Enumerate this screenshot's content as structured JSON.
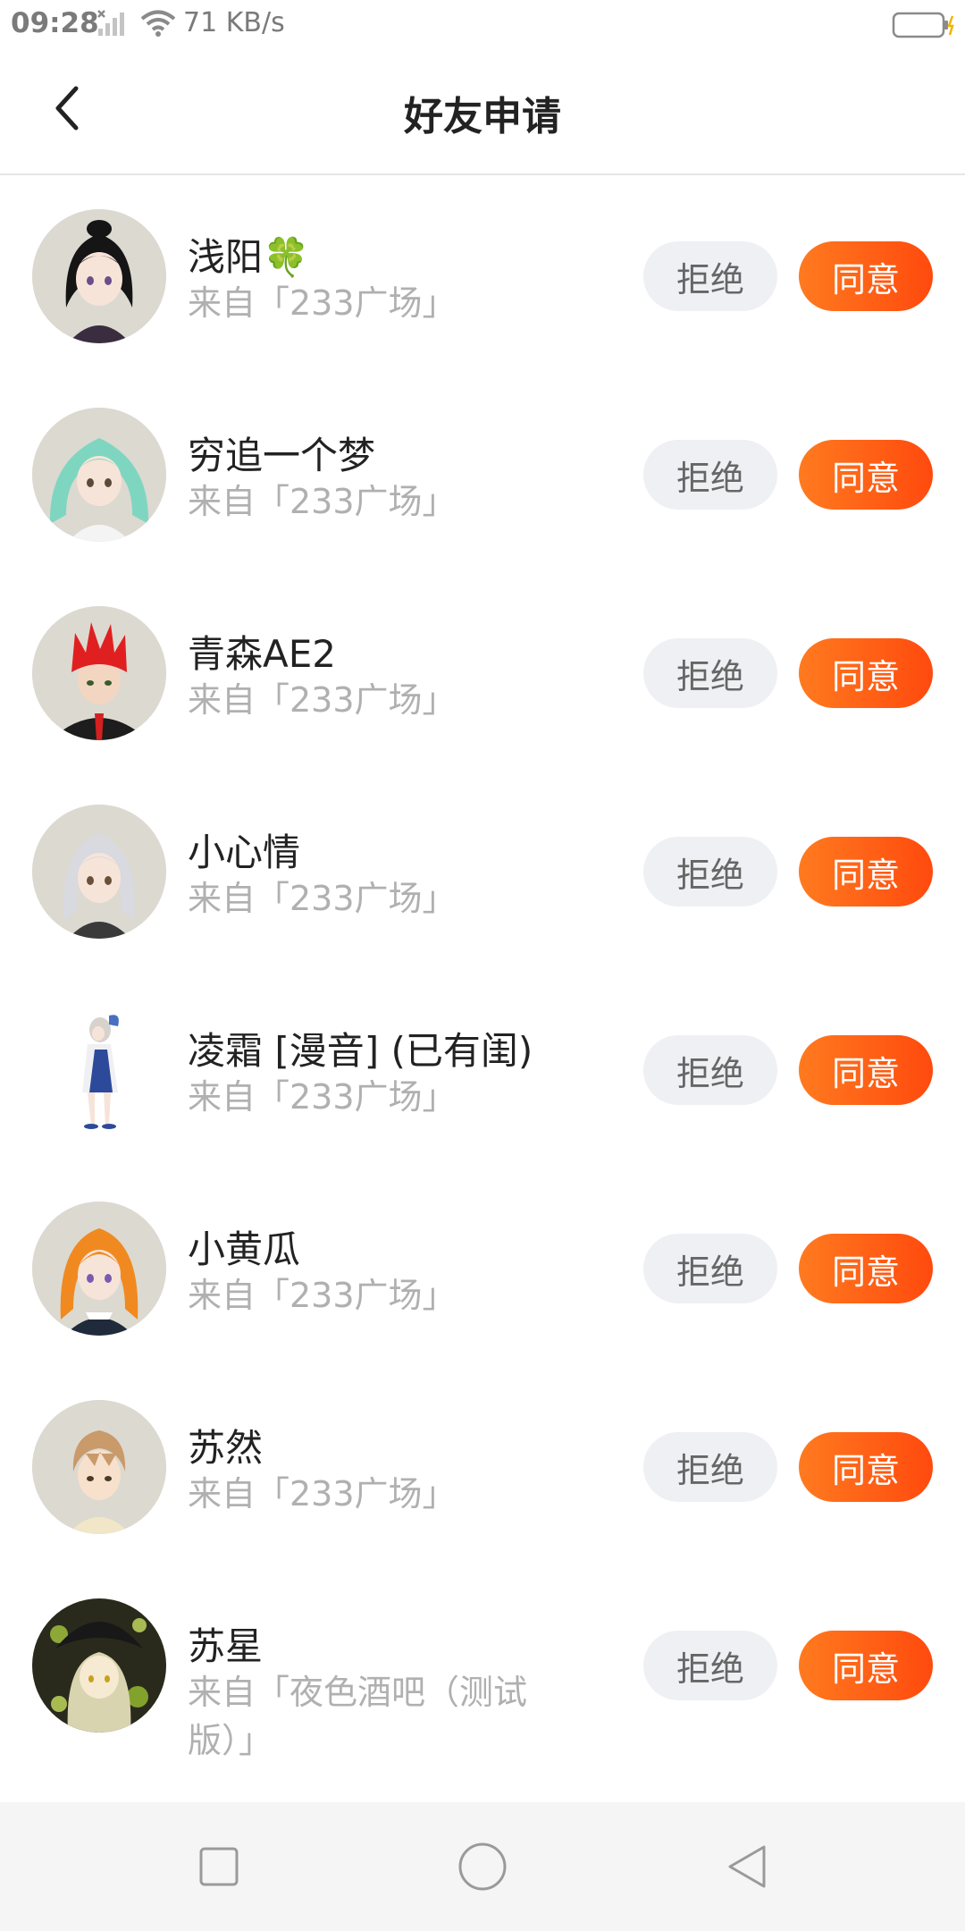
{
  "status_bar": {
    "time": "09:28",
    "net_speed": "71 KB/s"
  },
  "header": {
    "title": "好友申请"
  },
  "buttons": {
    "reject_label": "拒绝",
    "accept_label": "同意"
  },
  "requests": [
    {
      "name": "浅阳🍀",
      "source": "来自「233广场」",
      "avatar": "avatar-black-hair"
    },
    {
      "name": "穷追一个梦",
      "source": "来自「233广场」",
      "avatar": "avatar-teal-twintails"
    },
    {
      "name": "青森AE2",
      "source": "来自「233广场」",
      "avatar": "avatar-red-spiky"
    },
    {
      "name": "小心情",
      "source": "来自「233广场」",
      "avatar": "avatar-silver-hair"
    },
    {
      "name": "凌霜 [漫音] (已有闺)",
      "source": "来自「233广场」",
      "avatar": "avatar-fullbody-white"
    },
    {
      "name": "小黄瓜",
      "source": "来自「233广场」",
      "avatar": "avatar-orange-hair"
    },
    {
      "name": "苏然",
      "source": "来自「233广场」",
      "avatar": "avatar-brown-hair"
    },
    {
      "name": "苏星",
      "source": "来自「夜色酒吧（测试版）」",
      "avatar": "avatar-witch-hat"
    }
  ],
  "colors": {
    "accent": "#ff5a14",
    "reject_bg": "#eef0f4",
    "source_text": "#b0b0b0"
  },
  "nav_icons": [
    "recent-apps-icon",
    "home-icon",
    "back-triangle-icon"
  ]
}
